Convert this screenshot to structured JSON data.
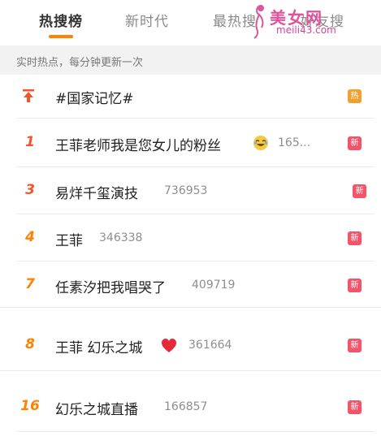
{
  "tabs": [
    {
      "label": "热搜榜"
    },
    {
      "label": "新时代"
    },
    {
      "label": "最热搜"
    },
    {
      "label": "好友搜"
    }
  ],
  "watermark": {
    "text": "美女网",
    "url": "meili43.com"
  },
  "subheader": {
    "text": "实时热点，每分钟更新一次"
  },
  "list": [
    {
      "rank": "",
      "title": "#国家记忆#",
      "count": "",
      "badge": "热",
      "badge_type": "hot",
      "icon": "pin-top-icon"
    },
    {
      "rank": "1",
      "title": "王菲老师我是您女儿的粉丝",
      "count": "165...",
      "badge": "新",
      "badge_type": "new",
      "icon": "laughing-face-emoji"
    },
    {
      "rank": "3",
      "title": "易烊千玺演技",
      "count": "736953",
      "badge": "新",
      "badge_type": "new"
    },
    {
      "rank": "4",
      "title": "王菲",
      "count": "346338",
      "badge": "新",
      "badge_type": "new"
    },
    {
      "rank": "7",
      "title": "任素汐把我唱哭了",
      "count": "409719",
      "badge": "新",
      "badge_type": "new"
    },
    {
      "rank": "8",
      "title": "王菲 幻乐之城",
      "count": "361664",
      "badge": "新",
      "badge_type": "new",
      "icon": "red-heart-emoji"
    },
    {
      "rank": "16",
      "title": "幻乐之城直播",
      "count": "166857",
      "badge": "新",
      "badge_type": "new"
    }
  ],
  "colors": {
    "accent": "#ff8200",
    "rank_top": "#f4542b",
    "badge_new": "#f4546a",
    "badge_hot": "#f0a030"
  }
}
